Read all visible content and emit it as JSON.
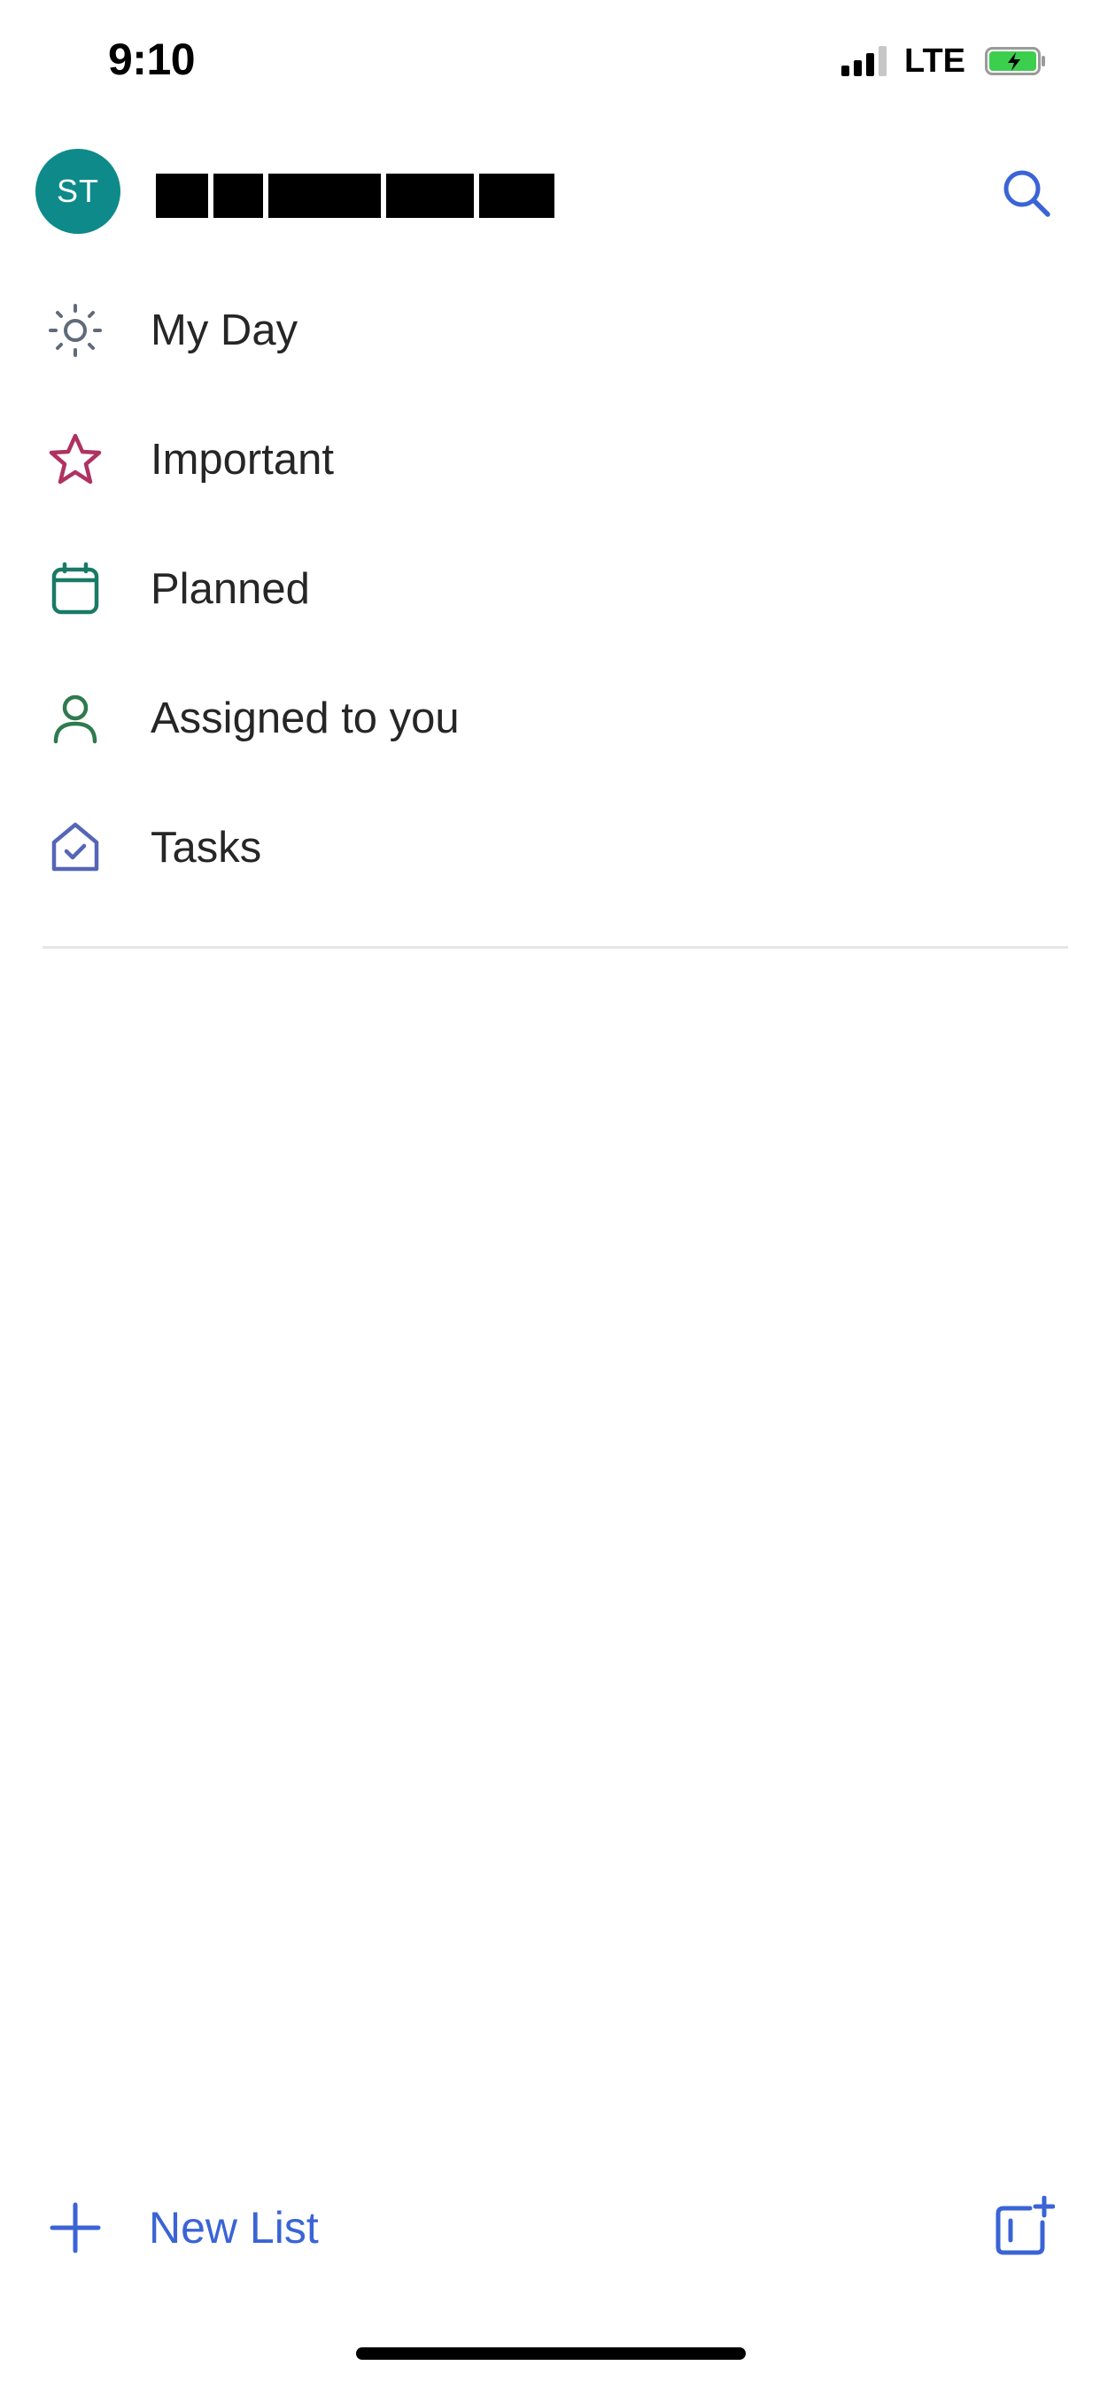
{
  "status_bar": {
    "time": "9:10",
    "network": "LTE"
  },
  "header": {
    "avatar_initials": "ST",
    "account_name_redacted": true
  },
  "nav": {
    "items": [
      {
        "label": "My Day",
        "icon": "sun-icon",
        "color": "#5f6b7a"
      },
      {
        "label": "Important",
        "icon": "star-icon",
        "color": "#b0325f"
      },
      {
        "label": "Planned",
        "icon": "calendar-icon",
        "color": "#1a7a66"
      },
      {
        "label": "Assigned to you",
        "icon": "person-icon",
        "color": "#2f7a4e"
      },
      {
        "label": "Tasks",
        "icon": "home-check-icon",
        "color": "#5566b8"
      }
    ]
  },
  "footer": {
    "new_list_label": "New List",
    "accent": "#3a64d6"
  },
  "colors": {
    "avatar_bg": "#0e8a8a",
    "search_icon": "#3a64d6",
    "battery_fill": "#3ccf4e"
  }
}
